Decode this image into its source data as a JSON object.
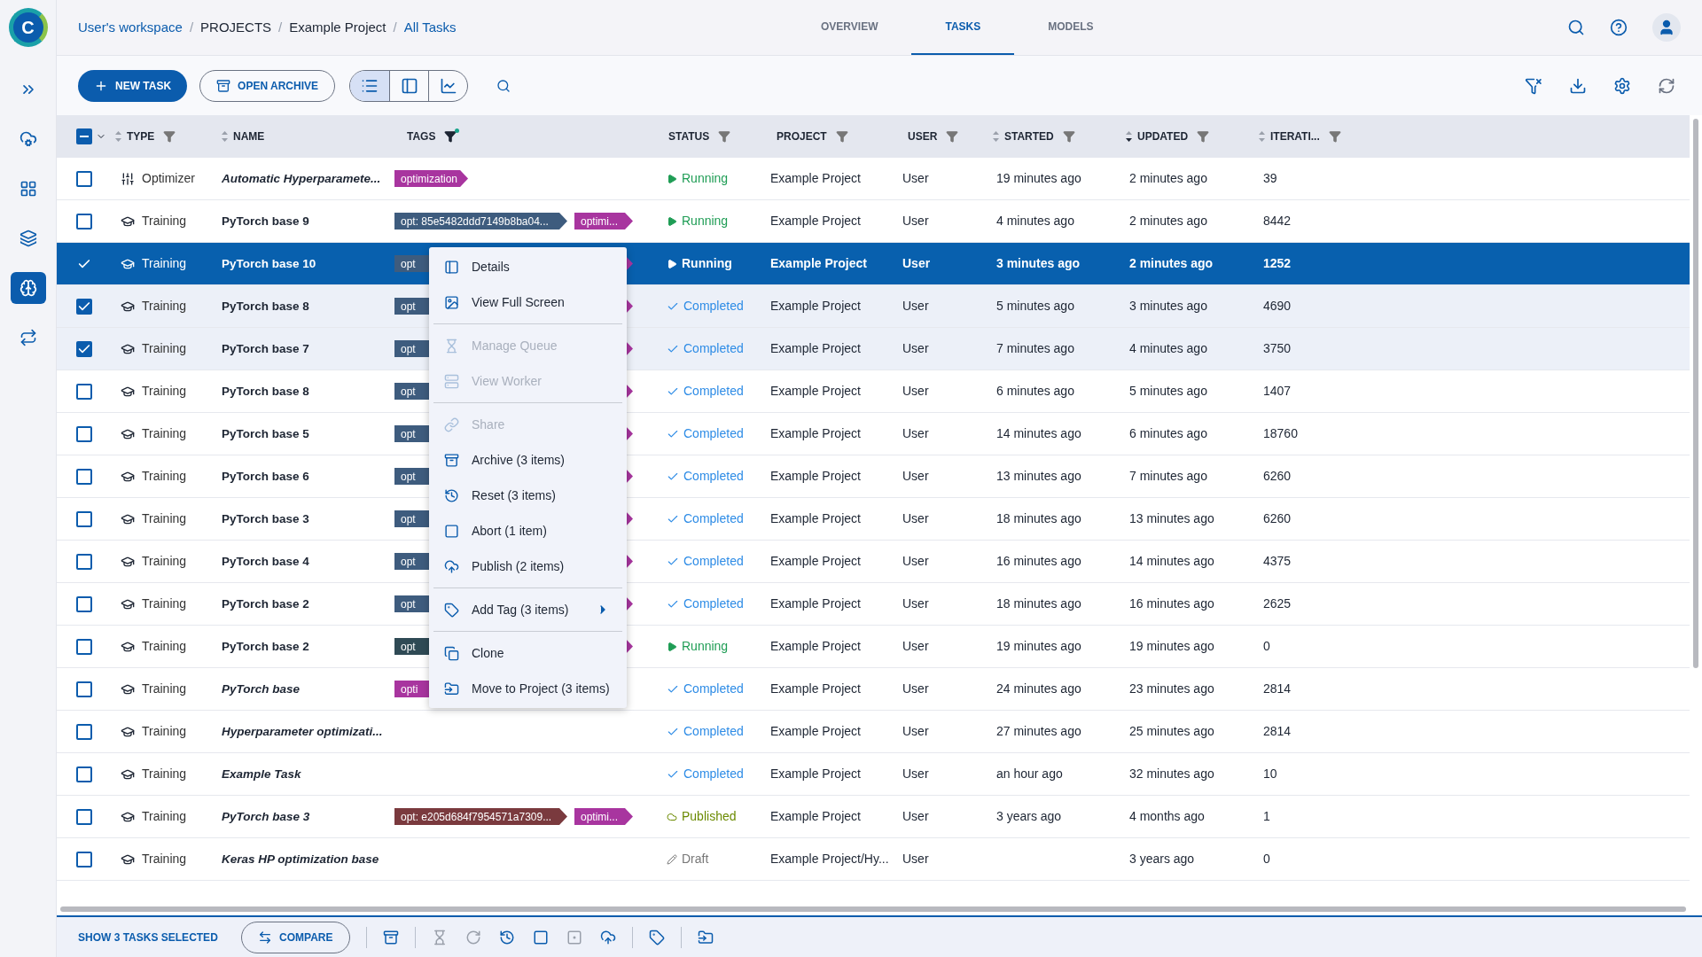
{
  "logo": {
    "letter": "C"
  },
  "sidebar": {
    "items": [
      {
        "selected": false
      },
      {
        "selected": false
      },
      {
        "selected": false
      },
      {
        "selected": false
      },
      {
        "selected": true
      },
      {
        "selected": false
      }
    ]
  },
  "breadcrumb": {
    "separator": "/",
    "items": [
      {
        "label": "User's workspace",
        "kind": "link"
      },
      {
        "label": "PROJECTS",
        "kind": "plain"
      },
      {
        "label": "Example Project",
        "kind": "plain"
      },
      {
        "label": "All Tasks",
        "kind": "current"
      }
    ]
  },
  "tabs": [
    {
      "label": "OVERVIEW",
      "selected": false
    },
    {
      "label": "TASKS",
      "selected": true
    },
    {
      "label": "MODELS",
      "selected": false
    }
  ],
  "toolbar": {
    "new_task": "NEW TASK",
    "open_archive": "OPEN ARCHIVE",
    "views": [
      {
        "selected": true
      },
      {
        "selected": false
      },
      {
        "selected": false
      }
    ]
  },
  "table": {
    "select_all_partial": true,
    "columns": [
      {
        "label": "TYPE",
        "sortable": true,
        "sort_desc": false,
        "filter": true,
        "filter_active": false
      },
      {
        "label": "NAME",
        "sortable": true,
        "sort_desc": false,
        "filter": false
      },
      {
        "label": "TAGS",
        "sortable": false,
        "filter": true,
        "filter_active": true
      },
      {
        "label": "STATUS",
        "sortable": false,
        "filter": true,
        "filter_active": false
      },
      {
        "label": "PROJECT",
        "sortable": false,
        "filter": true,
        "filter_active": false
      },
      {
        "label": "USER",
        "sortable": false,
        "filter": true,
        "filter_active": false
      },
      {
        "label": "STARTED",
        "sortable": true,
        "sort_desc": false,
        "filter": true,
        "filter_active": false
      },
      {
        "label": "UPDATED",
        "sortable": true,
        "sort_desc": true,
        "filter": true,
        "filter_active": false
      },
      {
        "label": "ITERATI...",
        "sortable": true,
        "sort_desc": false,
        "filter": true,
        "filter_active": false
      }
    ],
    "rows": [
      {
        "checked": false,
        "selected": false,
        "type": {
          "kind": "optimizer",
          "label": "Optimizer"
        },
        "name": "Automatic Hyperparamete...",
        "name_italic": true,
        "tags": [
          {
            "kind": "name",
            "label": "optimization",
            "color": "#a8359f"
          }
        ],
        "status": {
          "kind": "running",
          "label": "Running"
        },
        "project": "Example Project",
        "user": "User",
        "started": "19 minutes ago",
        "updated": "2 minutes ago",
        "iterations": "39"
      },
      {
        "checked": false,
        "selected": false,
        "type": {
          "kind": "training",
          "label": "Training"
        },
        "name": "PyTorch base 9",
        "name_italic": false,
        "tags": [
          {
            "kind": "hash",
            "label": "opt: 85e5482ddd7149b8ba04...",
            "color": "#3e5c7e"
          },
          {
            "kind": "name",
            "label": "optimi...",
            "color": "#a8359f"
          }
        ],
        "status": {
          "kind": "running",
          "label": "Running"
        },
        "project": "Example Project",
        "user": "User",
        "started": "4 minutes ago",
        "updated": "2 minutes ago",
        "iterations": "8442"
      },
      {
        "checked": true,
        "selected": true,
        "type": {
          "kind": "training",
          "label": "Training"
        },
        "name": "PyTorch base 10",
        "name_italic": false,
        "tags": [
          {
            "kind": "hash",
            "label": "opt",
            "color": "#3e5c7e"
          },
          {
            "kind": "name",
            "color": "#a8359f"
          }
        ],
        "status": {
          "kind": "running",
          "label": "Running"
        },
        "project": "Example Project",
        "user": "User",
        "started": "3 minutes ago",
        "updated": "2 minutes ago",
        "iterations": "1252"
      },
      {
        "checked": true,
        "selected": false,
        "type": {
          "kind": "training",
          "label": "Training"
        },
        "name": "PyTorch base 8",
        "name_italic": false,
        "tags": [
          {
            "kind": "hash",
            "label": "opt",
            "color": "#3e5c7e"
          },
          {
            "kind": "name",
            "color": "#a8359f"
          }
        ],
        "status": {
          "kind": "completed",
          "label": "Completed"
        },
        "project": "Example Project",
        "user": "User",
        "started": "5 minutes ago",
        "updated": "3 minutes ago",
        "iterations": "4690"
      },
      {
        "checked": true,
        "selected": false,
        "type": {
          "kind": "training",
          "label": "Training"
        },
        "name": "PyTorch base 7",
        "name_italic": false,
        "tags": [
          {
            "kind": "hash",
            "label": "opt",
            "color": "#3e5c7e"
          },
          {
            "kind": "name",
            "color": "#a8359f"
          }
        ],
        "status": {
          "kind": "completed",
          "label": "Completed"
        },
        "project": "Example Project",
        "user": "User",
        "started": "7 minutes ago",
        "updated": "4 minutes ago",
        "iterations": "3750"
      },
      {
        "checked": false,
        "selected": false,
        "type": {
          "kind": "training",
          "label": "Training"
        },
        "name": "PyTorch base 8",
        "name_italic": false,
        "tags": [
          {
            "kind": "hash",
            "label": "opt",
            "color": "#3e5c7e"
          },
          {
            "kind": "name",
            "color": "#a8359f"
          }
        ],
        "status": {
          "kind": "completed",
          "label": "Completed"
        },
        "project": "Example Project",
        "user": "User",
        "started": "6 minutes ago",
        "updated": "5 minutes ago",
        "iterations": "1407"
      },
      {
        "checked": false,
        "selected": false,
        "type": {
          "kind": "training",
          "label": "Training"
        },
        "name": "PyTorch base 5",
        "name_italic": false,
        "tags": [
          {
            "kind": "hash",
            "label": "opt",
            "color": "#3e5c7e"
          },
          {
            "kind": "name",
            "color": "#a8359f"
          }
        ],
        "status": {
          "kind": "completed",
          "label": "Completed"
        },
        "project": "Example Project",
        "user": "User",
        "started": "14 minutes ago",
        "updated": "6 minutes ago",
        "iterations": "18760"
      },
      {
        "checked": false,
        "selected": false,
        "type": {
          "kind": "training",
          "label": "Training"
        },
        "name": "PyTorch base 6",
        "name_italic": false,
        "tags": [
          {
            "kind": "hash",
            "label": "opt",
            "color": "#3e5c7e"
          },
          {
            "kind": "name",
            "color": "#a8359f"
          }
        ],
        "status": {
          "kind": "completed",
          "label": "Completed"
        },
        "project": "Example Project",
        "user": "User",
        "started": "13 minutes ago",
        "updated": "7 minutes ago",
        "iterations": "6260"
      },
      {
        "checked": false,
        "selected": false,
        "type": {
          "kind": "training",
          "label": "Training"
        },
        "name": "PyTorch base 3",
        "name_italic": false,
        "tags": [
          {
            "kind": "hash",
            "label": "opt",
            "color": "#3e5c7e"
          },
          {
            "kind": "name",
            "color": "#a8359f"
          }
        ],
        "status": {
          "kind": "completed",
          "label": "Completed"
        },
        "project": "Example Project",
        "user": "User",
        "started": "18 minutes ago",
        "updated": "13 minutes ago",
        "iterations": "6260"
      },
      {
        "checked": false,
        "selected": false,
        "type": {
          "kind": "training",
          "label": "Training"
        },
        "name": "PyTorch base 4",
        "name_italic": false,
        "tags": [
          {
            "kind": "hash",
            "label": "opt",
            "color": "#3e5c7e"
          },
          {
            "kind": "name",
            "color": "#a8359f"
          }
        ],
        "status": {
          "kind": "completed",
          "label": "Completed"
        },
        "project": "Example Project",
        "user": "User",
        "started": "16 minutes ago",
        "updated": "14 minutes ago",
        "iterations": "4375"
      },
      {
        "checked": false,
        "selected": false,
        "type": {
          "kind": "training",
          "label": "Training"
        },
        "name": "PyTorch base 2",
        "name_italic": false,
        "tags": [
          {
            "kind": "hash",
            "label": "opt",
            "color": "#3e5c7e"
          },
          {
            "kind": "name",
            "color": "#a8359f"
          }
        ],
        "status": {
          "kind": "completed",
          "label": "Completed"
        },
        "project": "Example Project",
        "user": "User",
        "started": "18 minutes ago",
        "updated": "16 minutes ago",
        "iterations": "2625"
      },
      {
        "checked": false,
        "selected": false,
        "type": {
          "kind": "training",
          "label": "Training"
        },
        "name": "PyTorch base 2",
        "name_italic": false,
        "tags": [
          {
            "kind": "hash",
            "label": "opt",
            "color": "#2f4a55"
          },
          {
            "kind": "name",
            "color": "#a8359f"
          }
        ],
        "status": {
          "kind": "running",
          "label": "Running"
        },
        "project": "Example Project",
        "user": "User",
        "started": "19 minutes ago",
        "updated": "19 minutes ago",
        "iterations": "0"
      },
      {
        "checked": false,
        "selected": false,
        "type": {
          "kind": "training",
          "label": "Training"
        },
        "name": "PyTorch base",
        "name_italic": true,
        "tags": [
          {
            "kind": "name",
            "label": "opti",
            "color": "#a8359f"
          }
        ],
        "status": {
          "kind": "completed",
          "label": "Completed"
        },
        "project": "Example Project",
        "user": "User",
        "started": "24 minutes ago",
        "updated": "23 minutes ago",
        "iterations": "2814"
      },
      {
        "checked": false,
        "selected": false,
        "type": {
          "kind": "training",
          "label": "Training"
        },
        "name": "Hyperparameter optimizati...",
        "name_italic": true,
        "tags": [],
        "status": {
          "kind": "completed",
          "label": "Completed"
        },
        "project": "Example Project",
        "user": "User",
        "started": "27 minutes ago",
        "updated": "25 minutes ago",
        "iterations": "2814"
      },
      {
        "checked": false,
        "selected": false,
        "type": {
          "kind": "training",
          "label": "Training"
        },
        "name": "Example Task",
        "name_italic": true,
        "tags": [],
        "status": {
          "kind": "completed",
          "label": "Completed"
        },
        "project": "Example Project",
        "user": "User",
        "started": "an hour ago",
        "updated": "32 minutes ago",
        "iterations": "10"
      },
      {
        "checked": false,
        "selected": false,
        "type": {
          "kind": "training",
          "label": "Training"
        },
        "name": "PyTorch base 3",
        "name_italic": true,
        "tags": [
          {
            "kind": "hash",
            "label": "opt: e205d684f7954571a7309...",
            "color": "#7a3a3e"
          },
          {
            "kind": "name",
            "label": "optimi...",
            "color": "#a8359f"
          }
        ],
        "status": {
          "kind": "published",
          "label": "Published"
        },
        "project": "Example Project",
        "user": "User",
        "started": "3 years ago",
        "updated": "4 months ago",
        "iterations": "1"
      },
      {
        "checked": false,
        "selected": false,
        "type": {
          "kind": "training",
          "label": "Training"
        },
        "name": "Keras HP optimization base",
        "name_italic": true,
        "tags": [],
        "status": {
          "kind": "draft",
          "label": "Draft"
        },
        "project": "Example Project/Hy...",
        "user": "User",
        "updated": "3 years ago",
        "iterations": "0"
      }
    ]
  },
  "context_menu": {
    "groups": [
      [
        {
          "label": "Details",
          "disabled": false
        },
        {
          "label": "View Full Screen",
          "disabled": false
        }
      ],
      [
        {
          "label": "Manage Queue",
          "disabled": true
        },
        {
          "label": "View Worker",
          "disabled": true
        }
      ],
      [
        {
          "label": "Share",
          "disabled": true
        },
        {
          "label": "Archive (3 items)",
          "disabled": false
        },
        {
          "label": "Reset (3 items)",
          "disabled": false
        },
        {
          "label": "Abort (1 item)",
          "disabled": false
        },
        {
          "label": "Publish (2 items)",
          "disabled": false
        }
      ],
      [
        {
          "label": "Add Tag (3 items)",
          "disabled": false,
          "submenu": true
        }
      ],
      [
        {
          "label": "Clone",
          "disabled": false
        },
        {
          "label": "Move to Project (3 items)",
          "disabled": false
        }
      ]
    ]
  },
  "bottom_bar": {
    "selection": "SHOW 3 TASKS SELECTED",
    "compare": "COMPARE",
    "actions": [
      {
        "disabled": false
      },
      {
        "disabled": true
      },
      {
        "disabled": true
      },
      {
        "disabled": false
      },
      {
        "disabled": false
      },
      {
        "disabled": true
      },
      {
        "disabled": false
      },
      {
        "disabled": false
      },
      {
        "disabled": false
      }
    ]
  }
}
